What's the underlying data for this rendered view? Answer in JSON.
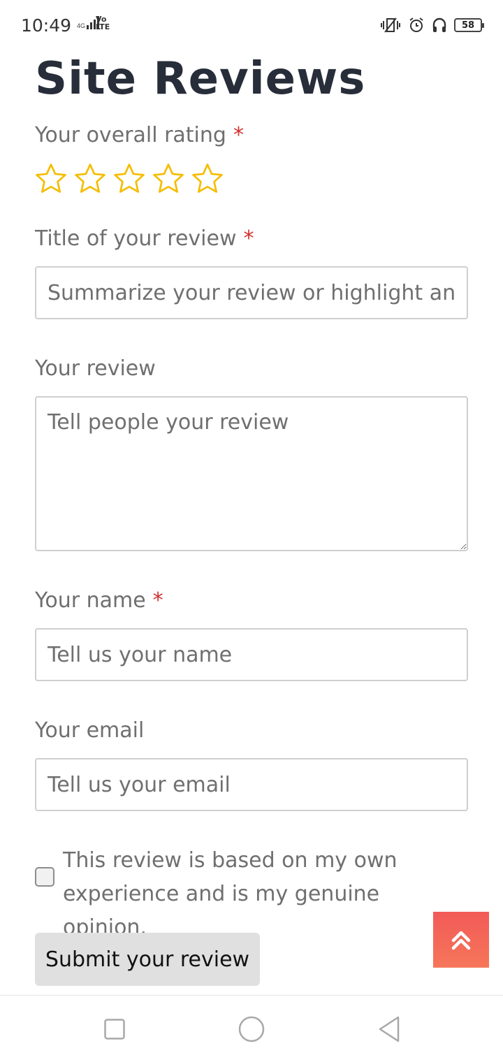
{
  "status_bar": {
    "time": "10:49",
    "network": "4G",
    "volte_top": "Vo",
    "volte_bottom": "LTE",
    "battery": "58",
    "icons": [
      "vibrate-icon",
      "alarm-icon",
      "headphones-icon",
      "battery-icon"
    ]
  },
  "page": {
    "title": "Site Reviews"
  },
  "form": {
    "rating_label": "Your overall rating",
    "required_mark": "*",
    "stars": [
      1,
      2,
      3,
      4,
      5
    ],
    "rating_value": 0,
    "title_label": "Title of your review",
    "title_placeholder": "Summarize your review or highlight an interesting detail",
    "review_label": "Your review",
    "review_placeholder": "Tell people your review",
    "name_label": "Your name",
    "name_placeholder": "Tell us your name",
    "email_label": "Your email",
    "email_placeholder": "Tell us your email",
    "consent_text": "This review is based on my own experience and is my genuine opinion.",
    "submit_label": "Submit your review"
  },
  "colors": {
    "title": "#282d3a",
    "required": "#d32f2f",
    "star": "#f5bd02",
    "scroll_top": "#f25a57"
  },
  "nav_bar": {
    "buttons": [
      "recents-icon",
      "home-icon",
      "back-icon"
    ]
  }
}
